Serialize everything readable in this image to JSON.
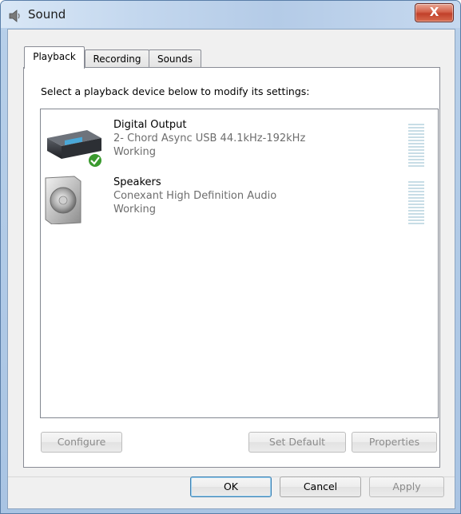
{
  "window": {
    "title": "Sound",
    "close_label": "X"
  },
  "tabs": [
    {
      "label": "Playback",
      "active": true
    },
    {
      "label": "Recording",
      "active": false
    },
    {
      "label": "Sounds",
      "active": false
    }
  ],
  "playback": {
    "instruction": "Select a playback device below to modify its settings:",
    "devices": [
      {
        "name": "Digital Output",
        "description": "2- Chord Async USB 44.1kHz-192kHz",
        "status": "Working",
        "icon": "digital-output-device-icon",
        "default": true
      },
      {
        "name": "Speakers",
        "description": "Conexant High Definition Audio",
        "status": "Working",
        "icon": "speaker-device-icon",
        "default": false
      }
    ],
    "buttons": {
      "configure": "Configure",
      "set_default": "Set Default",
      "properties": "Properties"
    }
  },
  "dialog_buttons": {
    "ok": "OK",
    "cancel": "Cancel",
    "apply": "Apply"
  },
  "colors": {
    "accent": "#3c7fb1",
    "close": "#c1402a",
    "meter": "#c8dde6",
    "secondary_text": "#6d6d6d"
  }
}
